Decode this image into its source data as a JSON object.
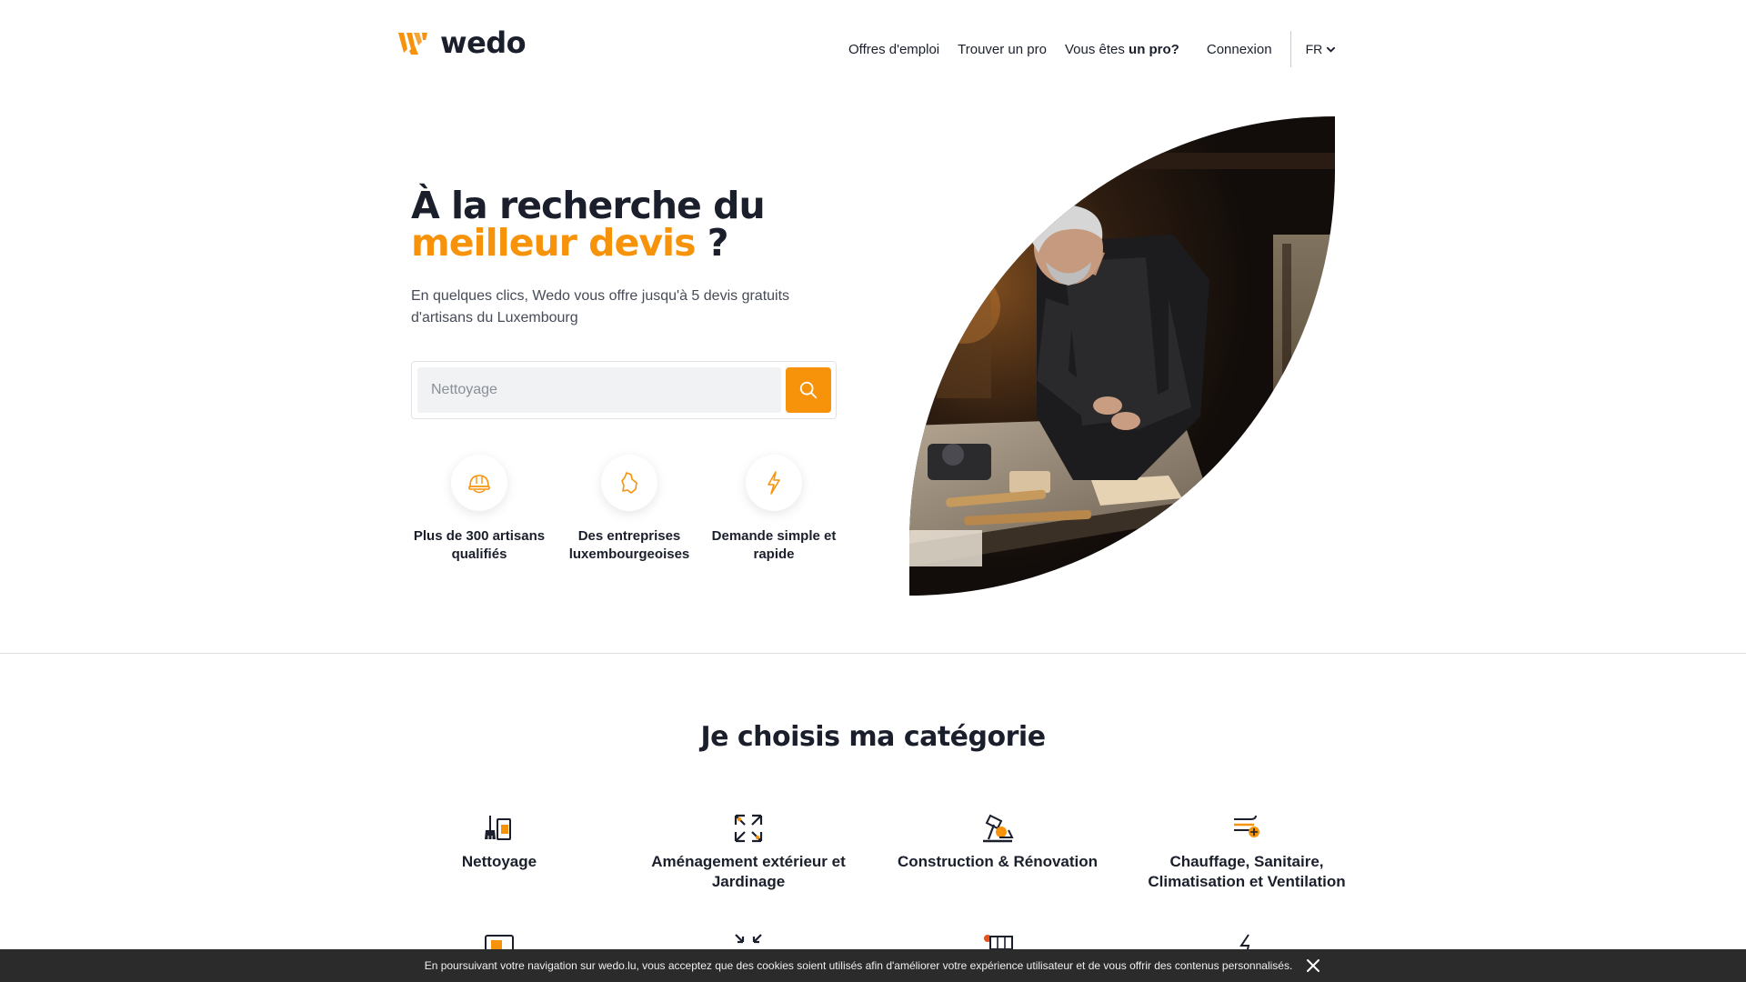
{
  "brand": {
    "name": "wedo",
    "accent": "#f7930a",
    "dark": "#1a1f2b"
  },
  "nav": {
    "jobs": "Offres d'emploi",
    "find_pro": "Trouver un pro",
    "are_you_pro_prefix": "Vous êtes",
    "are_you_pro_bold": "un pro?",
    "login": "Connexion",
    "language": "FR"
  },
  "hero": {
    "title_line1": "À la recherche du",
    "title_accent": "meilleur devis",
    "title_end": " ?",
    "subtitle": "En quelques clics, Wedo vous offre jusqu'à 5 devis gratuits d'artisans du Luxembourg",
    "search_placeholder": "Nettoyage"
  },
  "features": [
    {
      "icon": "helmet-icon",
      "label": "Plus de 300 artisans qualifiés"
    },
    {
      "icon": "luxembourg-map-icon",
      "label": "Des entreprises luxembourgeoises"
    },
    {
      "icon": "lightning-icon",
      "label": "Demande simple et rapide"
    }
  ],
  "categories": {
    "title": "Je choisis ma catégorie",
    "items": [
      {
        "icon": "cleaning-icon",
        "label": "Nettoyage"
      },
      {
        "icon": "expand-arrows-icon",
        "label": "Aménagement extérieur et Jardinage"
      },
      {
        "icon": "construction-icon",
        "label": "Construction & Rénovation"
      },
      {
        "icon": "heating-icon",
        "label": "Chauffage, Sanitaire, Climatisation et Ventilation"
      }
    ]
  },
  "cookie": {
    "text": "En poursuivant votre navigation sur wedo.lu, vous acceptez que des cookies soient utilisés afin d'améliorer votre expérience utilisateur et de vous offrir des contenus personnalisés."
  }
}
